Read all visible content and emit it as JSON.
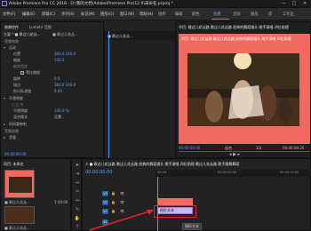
{
  "window": {
    "title": "Adobe Premiere Pro CC 2018 - D:\\我的文档\\Adobe\\Premiere Pro\\12.0\\未命名.prproj *",
    "minimize": "—",
    "maximize": "□",
    "close": "✕"
  },
  "menu": [
    "文件(F)",
    "编辑(E)",
    "剪辑(C)",
    "序列(S)",
    "标记(M)",
    "图形(G)",
    "窗口(W)",
    "帮助(H)"
  ],
  "workspaces": [
    {
      "label": "组件",
      "active": false
    },
    {
      "label": "编辑",
      "active": false
    },
    {
      "label": "颜色",
      "active": false
    },
    {
      "label": "效果",
      "active": true
    },
    {
      "label": "音频",
      "active": false
    },
    {
      "label": "图形",
      "active": false
    },
    {
      "label": "库",
      "active": false
    },
    {
      "label": "工作区",
      "active": false
    }
  ],
  "effect_controls": {
    "tabs": [
      "效果控件",
      "Lumetri 范围"
    ],
    "source_label": "主要 * ■ 歌过儿花丛...",
    "sequence_label": "■ 歌过儿花丛...",
    "timecode": "00:00",
    "clip_label": "■ 歌过儿花丛...",
    "video_header": "视频效果",
    "rows": [
      {
        "label": "运动",
        "value": "",
        "indent": 0
      },
      {
        "label": "位置",
        "value": "360.0  240.0",
        "indent": 1
      },
      {
        "label": "缩放",
        "value": "100.0",
        "indent": 1
      },
      {
        "label": "缩放宽度",
        "value": "",
        "indent": 1
      },
      {
        "label": "等比缩放",
        "value": "",
        "indent": 1
      },
      {
        "label": "旋转",
        "value": "0.0",
        "indent": 1
      },
      {
        "label": "锚点",
        "value": "360.0  240.0",
        "indent": 1
      },
      {
        "label": "防闪烁滤镜",
        "value": "0.00",
        "indent": 1
      },
      {
        "label": "不透明度",
        "value": "",
        "indent": 0
      },
      {
        "label": "不透明度",
        "value": "100.0 %",
        "indent": 1
      },
      {
        "label": "混合模式",
        "value": "正常",
        "indent": 1
      },
      {
        "label": "时间重映射",
        "value": "",
        "indent": 0
      }
    ],
    "audio_header": "音频效果",
    "audio_rows": [
      {
        "label": "音量",
        "value": ""
      }
    ],
    "bottom_timecode": "00:00:00:00"
  },
  "source_monitor": {
    "tab": "节目: 歌过儿花丛路...",
    "clip_label": "歌过儿花丛路..."
  },
  "program_monitor": {
    "tab": "节目: 歌过儿花丛路 歌过儿花丛路 经典的舞蹈镜头 歌手演唱 四位助理",
    "timecode": "00:00:00:00",
    "fit": "适合",
    "scale": "1/2",
    "duration": "00:00:08:26"
  },
  "project_panel": {
    "tab": "项目: 未命名",
    "clip1_name": "■ 歌过儿花丛...",
    "clip1_dur": "1:40:00",
    "clip2_name": "■ 歌过儿花丛...",
    "clip2_dur": "0:00"
  },
  "timeline": {
    "tab": "× ■ 歌过儿花丛路 歌过儿花丛路 经典的舞蹈镜头 歌手演唱 四位助理 歌过儿花丛路 歌手跳舞舞蹈",
    "timecode": "00:00:00:00",
    "ruler": [
      "00:00",
      "00:00:05:00",
      "00:00:10:00"
    ],
    "tracks": [
      "V3",
      "V2",
      "V1",
      "A1",
      "A2"
    ],
    "clip_label": "图形文本",
    "tooltip": "图形文本"
  },
  "colors": {
    "accent": "#4f9cff",
    "clip_red": "#f06a5f",
    "clip_purple": "#c9b4f0",
    "annotation_red": "#e8232a"
  }
}
